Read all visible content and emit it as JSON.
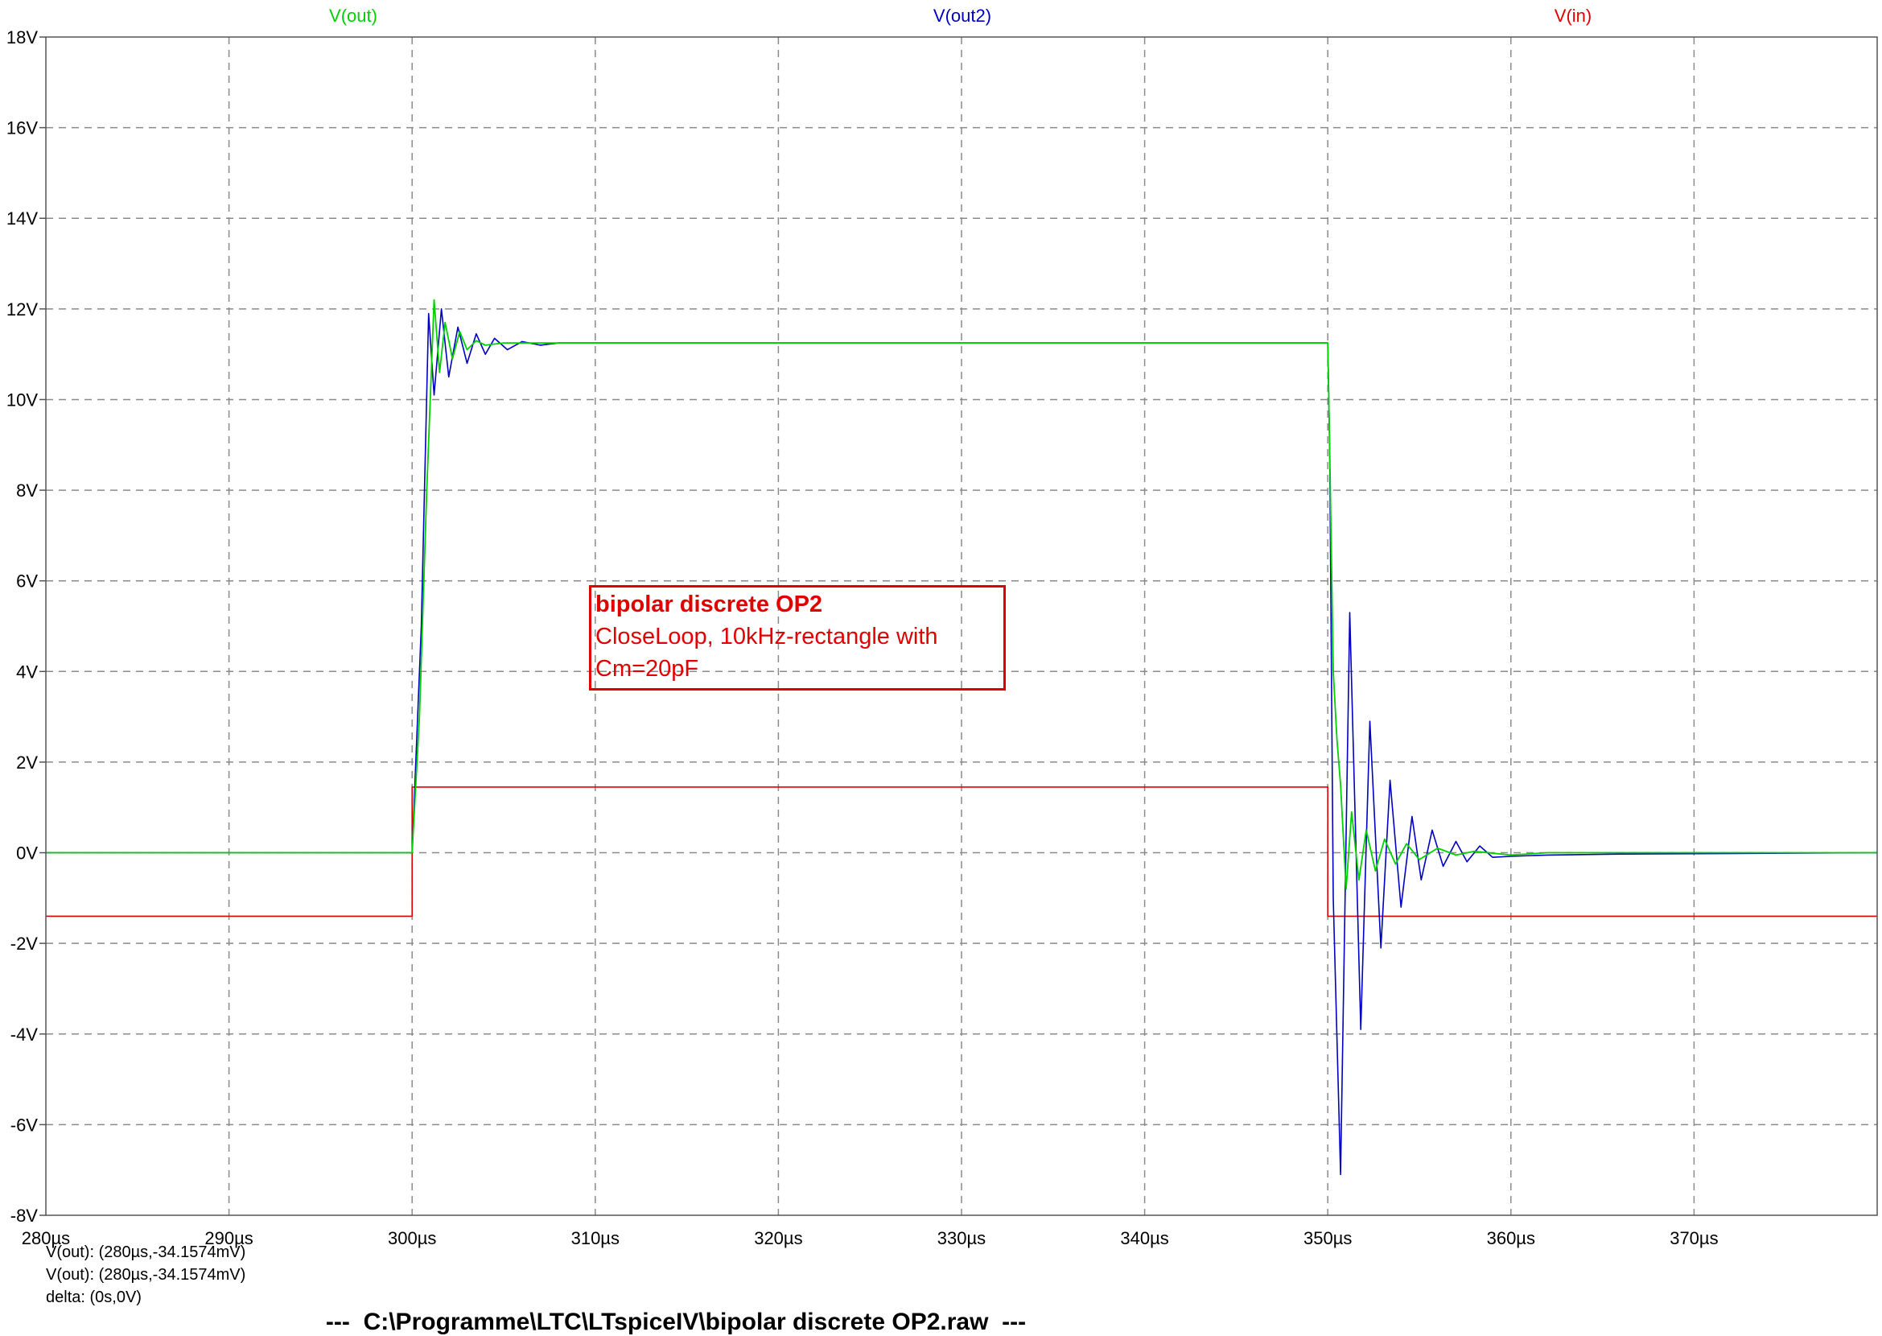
{
  "chart_data": {
    "type": "line",
    "x_unit": "µs",
    "xlim": [
      280,
      380
    ],
    "ylim": [
      -8,
      18
    ],
    "x_ticks": [
      "280µs",
      "290µs",
      "300µs",
      "310µs",
      "320µs",
      "330µs",
      "340µs",
      "350µs",
      "360µs",
      "370µs"
    ],
    "y_ticks": [
      "18V",
      "16V",
      "14V",
      "12V",
      "10V",
      "8V",
      "6V",
      "4V",
      "2V",
      "0V",
      "-2V",
      "-4V",
      "-6V",
      "-8V"
    ],
    "grid": true,
    "series": [
      {
        "name": "V(out)",
        "color": "#00d000",
        "points": [
          [
            280,
            0
          ],
          [
            300,
            0
          ],
          [
            300.4,
            3
          ],
          [
            300.8,
            8
          ],
          [
            301.2,
            12.2
          ],
          [
            301.5,
            10.6
          ],
          [
            301.8,
            11.7
          ],
          [
            302.2,
            10.9
          ],
          [
            302.6,
            11.5
          ],
          [
            303,
            11.1
          ],
          [
            303.5,
            11.3
          ],
          [
            304,
            11.2
          ],
          [
            305,
            11.25
          ],
          [
            310,
            11.25
          ],
          [
            350,
            11.25
          ],
          [
            350.1,
            9
          ],
          [
            350.3,
            4
          ],
          [
            350.5,
            2.5
          ],
          [
            350.7,
            1.5
          ],
          [
            351,
            -0.8
          ],
          [
            351.3,
            0.9
          ],
          [
            351.7,
            -0.6
          ],
          [
            352.1,
            0.5
          ],
          [
            352.6,
            -0.4
          ],
          [
            353.1,
            0.3
          ],
          [
            353.7,
            -0.25
          ],
          [
            354.3,
            0.2
          ],
          [
            355,
            -0.15
          ],
          [
            356,
            0.1
          ],
          [
            357,
            -0.05
          ],
          [
            358,
            0.03
          ],
          [
            360,
            -0.05
          ],
          [
            362,
            0
          ],
          [
            380,
            0
          ]
        ]
      },
      {
        "name": "V(out2)",
        "color": "#0000c0",
        "points": [
          [
            280,
            0
          ],
          [
            300,
            0
          ],
          [
            300.5,
            5
          ],
          [
            300.9,
            11.9
          ],
          [
            301.2,
            10.1
          ],
          [
            301.6,
            12.0
          ],
          [
            302,
            10.5
          ],
          [
            302.5,
            11.6
          ],
          [
            303,
            10.8
          ],
          [
            303.5,
            11.45
          ],
          [
            304,
            11.0
          ],
          [
            304.5,
            11.35
          ],
          [
            305.2,
            11.1
          ],
          [
            306,
            11.28
          ],
          [
            307,
            11.2
          ],
          [
            308,
            11.25
          ],
          [
            310,
            11.25
          ],
          [
            350,
            11.25
          ],
          [
            350.1,
            9
          ],
          [
            350.3,
            -1
          ],
          [
            350.7,
            -7.1
          ],
          [
            351.2,
            5.3
          ],
          [
            351.8,
            -3.9
          ],
          [
            352.3,
            2.9
          ],
          [
            352.9,
            -2.1
          ],
          [
            353.4,
            1.6
          ],
          [
            354,
            -1.2
          ],
          [
            354.6,
            0.8
          ],
          [
            355.1,
            -0.6
          ],
          [
            355.7,
            0.5
          ],
          [
            356.3,
            -0.3
          ],
          [
            357,
            0.25
          ],
          [
            357.6,
            -0.2
          ],
          [
            358.3,
            0.15
          ],
          [
            359,
            -0.1
          ],
          [
            360,
            -0.08
          ],
          [
            362,
            -0.05
          ],
          [
            366,
            -0.03
          ],
          [
            380,
            0
          ]
        ]
      },
      {
        "name": "V(in)",
        "color": "#e00000",
        "points": [
          [
            280,
            -1.4
          ],
          [
            300,
            -1.4
          ],
          [
            300,
            1.45
          ],
          [
            350,
            1.45
          ],
          [
            350,
            -1.4
          ],
          [
            380,
            -1.4
          ]
        ]
      }
    ]
  },
  "annotation": {
    "title": "bipolar discrete OP2",
    "line1": "CloseLoop, 10kHz-rectangle with",
    "line2": "Cm=20pF"
  },
  "cursor": {
    "line1": "V(out): (280µs,-34.1574mV)",
    "line2": "V(out): (280µs,-34.1574mV)",
    "line3": "delta: (0s,0V)"
  },
  "footer": {
    "path": "---  C:\\Programme\\LTC\\LTspiceIV\\bipolar discrete OP2.raw  ---"
  }
}
